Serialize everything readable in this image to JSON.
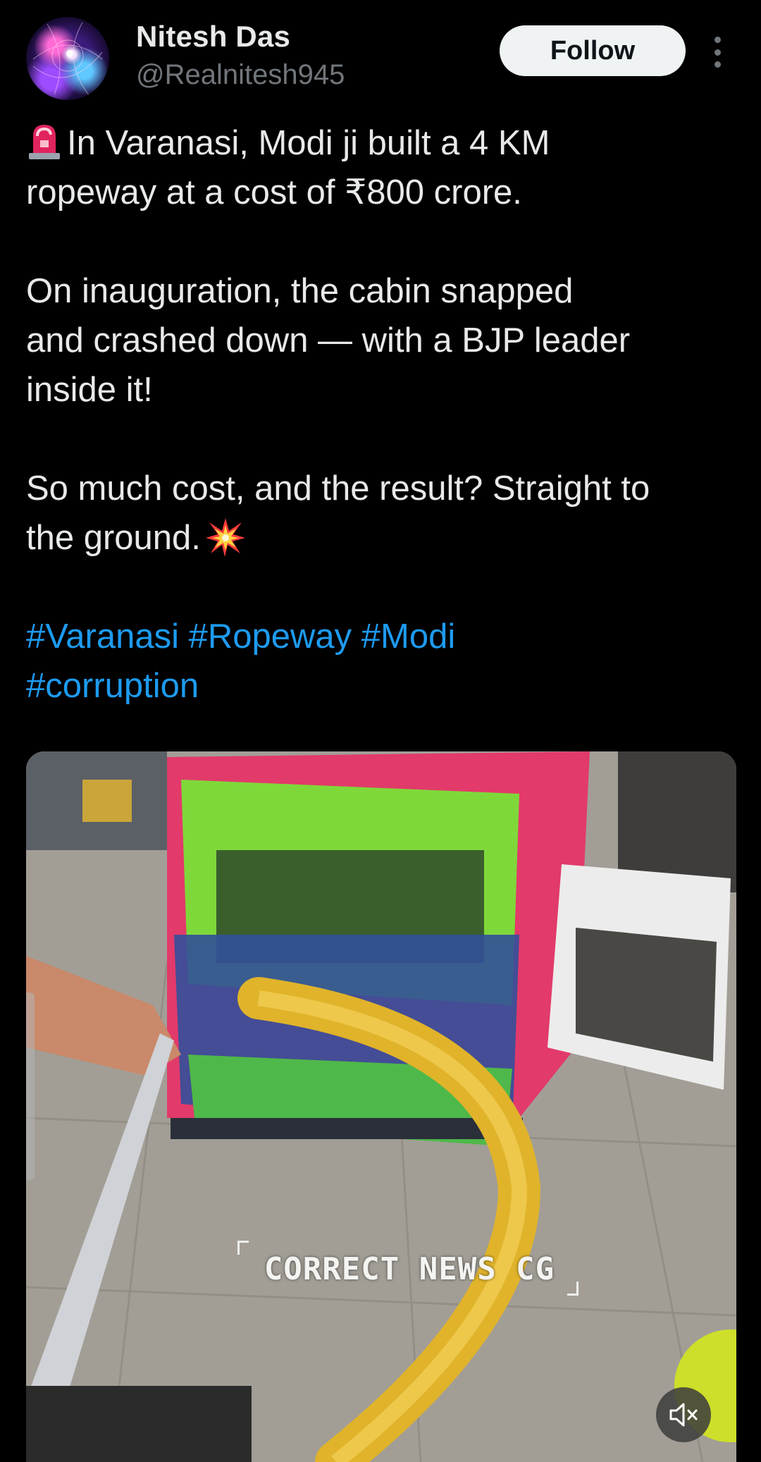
{
  "author": {
    "name": "Nitesh Das",
    "handle": "@Realnitesh945",
    "follow_label": "Follow"
  },
  "tweet": {
    "line1": "In Varanasi, Modi ji built a 4 KM",
    "line2": "ropeway at a cost of ₹800 crore.",
    "para2_line1": "On inauguration, the cabin snapped",
    "para2_line2": "and crashed down — with a BJP leader",
    "para2_line3": "inside it!",
    "para3_line1": "So much cost, and the result? Straight to",
    "para3_line2": "the ground.",
    "hashtags": [
      "#Varanasi",
      "#Ropeway",
      "#Modi",
      "#corruption"
    ]
  },
  "media": {
    "watermark": "CORRECT NEWS CG",
    "mute_icon": "speaker-muted-icon"
  },
  "colors": {
    "background": "#000000",
    "text": "#e7e9ea",
    "muted": "#71767b",
    "link": "#1d9bf0",
    "follow_bg": "#eff3f4"
  }
}
